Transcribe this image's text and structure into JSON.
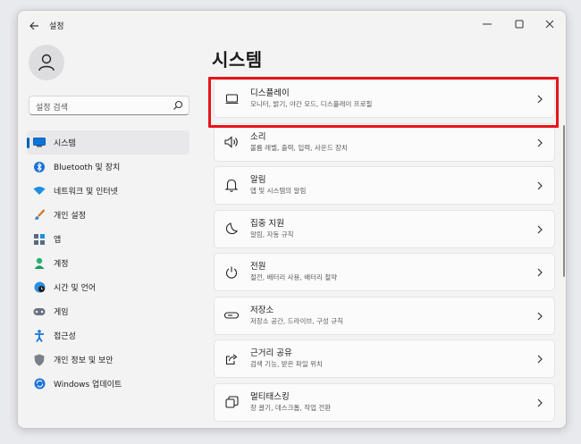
{
  "window": {
    "title": "설정"
  },
  "search": {
    "placeholder": "설정 검색"
  },
  "page": {
    "title": "시스템"
  },
  "sidebar": {
    "items": [
      {
        "label": "시스템",
        "icon": "system-icon",
        "active": true
      },
      {
        "label": "Bluetooth 및 장치",
        "icon": "bluetooth-icon"
      },
      {
        "label": "네트워크 및 인터넷",
        "icon": "wifi-icon"
      },
      {
        "label": "개인 설정",
        "icon": "brush-icon"
      },
      {
        "label": "앱",
        "icon": "apps-icon"
      },
      {
        "label": "계정",
        "icon": "account-icon"
      },
      {
        "label": "시간 및 언어",
        "icon": "globe-clock-icon"
      },
      {
        "label": "게임",
        "icon": "gamepad-icon"
      },
      {
        "label": "접근성",
        "icon": "accessibility-icon"
      },
      {
        "label": "개인 정보 및 보안",
        "icon": "shield-icon"
      },
      {
        "label": "Windows 업데이트",
        "icon": "update-icon"
      }
    ]
  },
  "cards": [
    {
      "title": "디스플레이",
      "subtitle": "모니터, 밝기, 야간 모드, 디스플레이 프로필",
      "icon": "monitor-icon"
    },
    {
      "title": "소리",
      "subtitle": "볼륨 레벨, 출력, 입력, 사운드 장치",
      "icon": "speaker-icon"
    },
    {
      "title": "알림",
      "subtitle": "앱 및 시스템의 알림",
      "icon": "bell-icon"
    },
    {
      "title": "집중 지원",
      "subtitle": "알림, 자동 규칙",
      "icon": "moon-icon"
    },
    {
      "title": "전원",
      "subtitle": "절전, 배터리 사용, 배터리 절약",
      "icon": "power-icon"
    },
    {
      "title": "저장소",
      "subtitle": "저장소 공간, 드라이브, 구성 규칙",
      "icon": "storage-icon"
    },
    {
      "title": "근거리 공유",
      "subtitle": "검색 기능, 받은 파일 위치",
      "icon": "share-icon"
    },
    {
      "title": "멀티태스킹",
      "subtitle": "창 끌기, 데스크톱, 작업 전환",
      "icon": "multitask-icon"
    }
  ],
  "colors": {
    "accent": "#005fb8",
    "highlight": "#e8141b"
  }
}
